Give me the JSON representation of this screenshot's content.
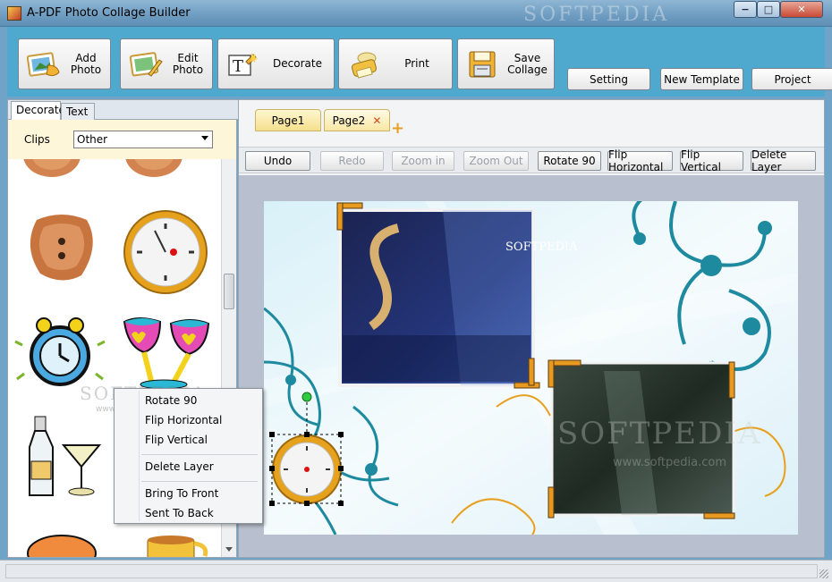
{
  "window": {
    "title": "A-PDF Photo Collage Builder",
    "watermark": "SOFTPEDIA",
    "minimize": "−",
    "maximize": "□",
    "close": "✕"
  },
  "toolbar": {
    "buttons": [
      {
        "label": "Add\nPhoto",
        "icon": "add-photo-icon"
      },
      {
        "label": "Edit\nPhoto",
        "icon": "edit-photo-icon"
      },
      {
        "label": "Decorate",
        "icon": "decorate-icon"
      },
      {
        "label": "Print",
        "icon": "print-icon"
      },
      {
        "label": "Save\nCollage",
        "icon": "save-icon"
      }
    ],
    "setting": "Setting",
    "new_template": "New Template",
    "project": "Project"
  },
  "left_panel": {
    "tabs": [
      "Decorate",
      "Text"
    ],
    "active_tab": "Decorate",
    "clips_label": "Clips",
    "clips_value": "Other",
    "gallery_watermark": "SOFTPEDIA",
    "gallery_watermark_url": "www.softpedia.com"
  },
  "pages": {
    "tabs": [
      {
        "label": "Page1",
        "active": false
      },
      {
        "label": "Page2",
        "active": true
      }
    ],
    "close_mark": "✕",
    "add_tab": "+"
  },
  "actions": {
    "undo": "Undo",
    "redo": "Redo",
    "zoom_in": "Zoom in",
    "zoom_out": "Zoom Out",
    "rotate": "Rotate 90",
    "flip_h": "Flip Horizontal",
    "flip_v": "Flip Vertical",
    "delete_layer": "Delete Layer"
  },
  "canvas": {
    "photo1_text": "SOFTPEDIA",
    "photo2_text": "SOFTPEDIA",
    "photo2_url": "www.softpedia.com"
  },
  "context_menu": {
    "items": [
      "Rotate 90",
      "Flip Horizontal",
      "Flip Vertical",
      "Delete Layer",
      "Bring To Front",
      "Sent To Back"
    ]
  },
  "colors": {
    "toolbar_bg": "#4fa9cf",
    "clips_bg": "#fdf6d9",
    "canvas_swirl": "#1e8aa0",
    "page_tab": "#f5e08e"
  }
}
